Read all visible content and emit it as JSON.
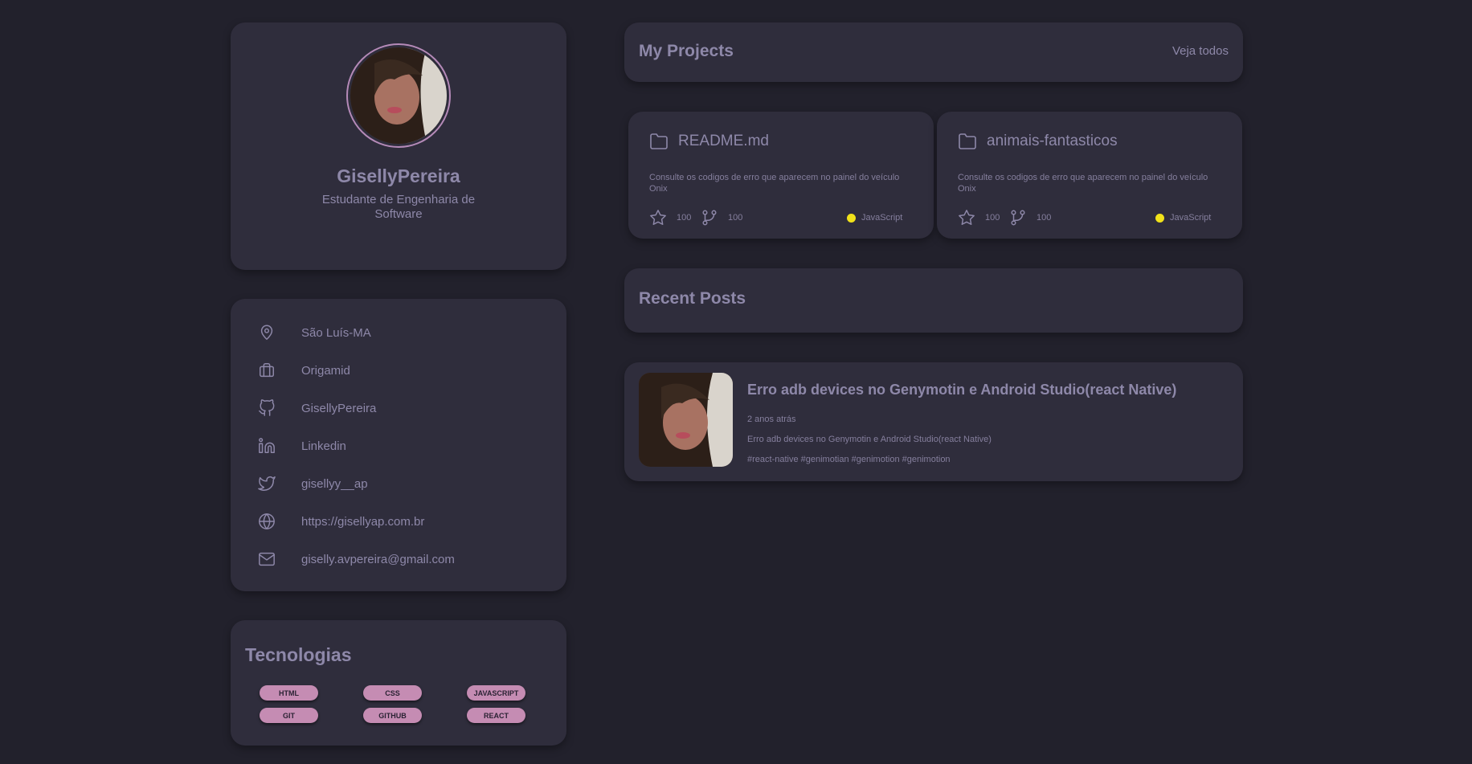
{
  "profile": {
    "name": "GisellyPereira",
    "role": "Estudante de Engenharia de Software"
  },
  "info": {
    "items": [
      {
        "icon": "map-pin-icon",
        "label": "São Luís-MA"
      },
      {
        "icon": "briefcase-icon",
        "label": "Origamid"
      },
      {
        "icon": "github-icon",
        "label": "GisellyPereira"
      },
      {
        "icon": "linkedin-icon",
        "label": "Linkedin"
      },
      {
        "icon": "twitter-icon",
        "label": "gisellyy__ap"
      },
      {
        "icon": "globe-icon",
        "label": "https://gisellyap.com.br"
      },
      {
        "icon": "mail-icon",
        "label": "giselly.avpereira@gmail.com"
      }
    ]
  },
  "tech": {
    "title": "Tecnologias",
    "tags": [
      "HTML",
      "CSS",
      "JAVASCRIPT",
      "GIT",
      "GITHUB",
      "REACT"
    ]
  },
  "projects": {
    "title": "My Projects",
    "see_all": "Veja todos",
    "items": [
      {
        "name": "README.md",
        "description": "Consulte os codigos de erro que aparecem no painel do veículo Onix",
        "stars": "100",
        "forks": "100",
        "language": "JavaScript",
        "language_color": "#f1e21a"
      },
      {
        "name": "animais-fantasticos",
        "description": "Consulte os codigos de erro que aparecem no painel do veículo Onix",
        "stars": "100",
        "forks": "100",
        "language": "JavaScript",
        "language_color": "#f1e21a"
      }
    ]
  },
  "posts": {
    "title": "Recent Posts",
    "items": [
      {
        "title": "Erro adb devices no Genymotin e Android Studio(react Native)",
        "date": "2 anos atrás",
        "body": "Erro adb devices no Genymotin e Android Studio(react Native)",
        "tags": "#react-native #genimotian #genimotion #genimotion"
      }
    ]
  },
  "colors": {
    "background": "#22212c",
    "card": "#2f2d3c",
    "text": "#8e88a9",
    "accent": "#c58cb3",
    "language_dot": "#f1e21a"
  }
}
